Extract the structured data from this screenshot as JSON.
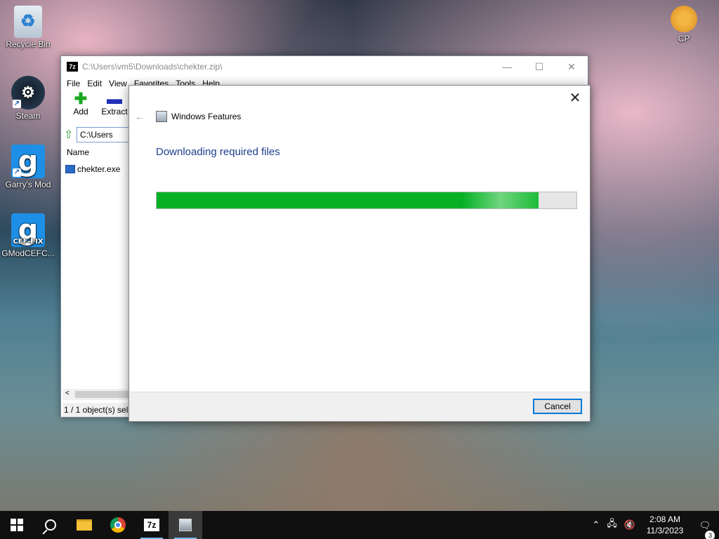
{
  "desktop": {
    "icons": [
      {
        "label": "Recycle Bin",
        "icon": "recycle-bin-icon"
      },
      {
        "label": "Steam",
        "icon": "steam-icon"
      },
      {
        "label": "Garry's Mod",
        "icon": "gmod-icon"
      },
      {
        "label": "GModCEFC...",
        "icon": "gmod-cef-fix-icon",
        "badge": "CEF-FIX"
      },
      {
        "label": "CP",
        "icon": "cp-icon"
      }
    ]
  },
  "zip_window": {
    "title": "C:\\Users\\vm5\\Downloads\\chekter.zip\\",
    "app_badge": "7z",
    "menu": [
      "File",
      "Edit",
      "View",
      "Favorites",
      "Tools",
      "Help"
    ],
    "toolbar": {
      "add": "Add",
      "extract": "Extract"
    },
    "address": "C:\\Users",
    "column_name": "Name",
    "files": [
      {
        "name": "chekter.exe"
      }
    ],
    "status": "1 / 1 object(s) sele"
  },
  "dialog": {
    "window_title": "Windows Features",
    "heading": "Downloading required files",
    "progress": 0.91,
    "cancel_label": "Cancel"
  },
  "taskbar": {
    "apps": [
      "start",
      "search",
      "file-explorer",
      "chrome",
      "7-zip",
      "windows-features"
    ],
    "sevenzip_label": "7z",
    "time": "2:08 AM",
    "date": "11/3/2023",
    "notification_count": "3"
  }
}
